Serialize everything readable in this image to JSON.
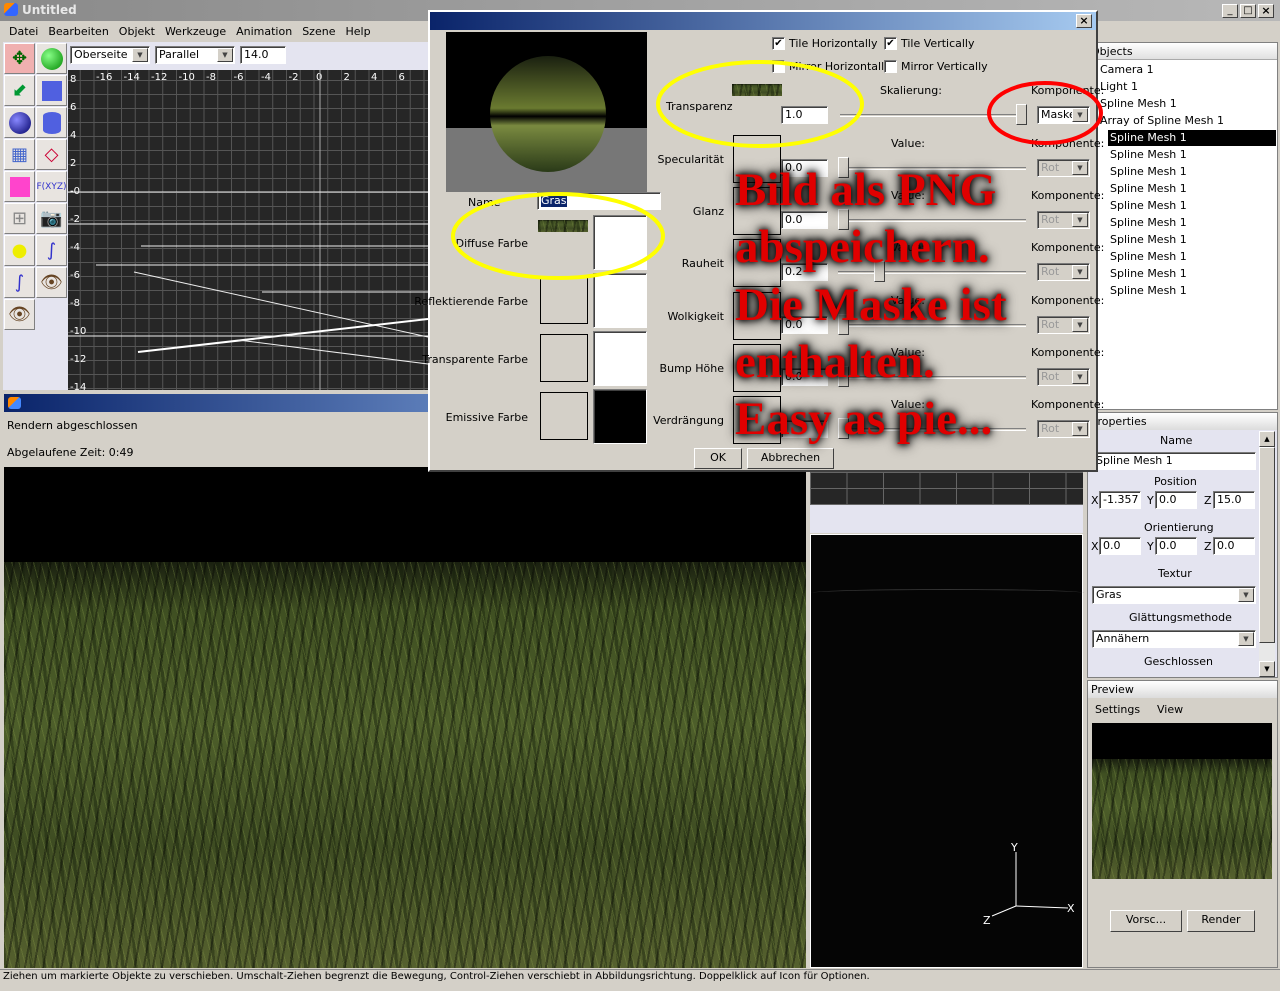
{
  "app": {
    "title": "Untitled",
    "window_controls": [
      "_",
      "□",
      "×"
    ]
  },
  "menu": [
    "Datei",
    "Bearbeiten",
    "Objekt",
    "Werkzeuge",
    "Animation",
    "Szene",
    "Help"
  ],
  "toolbar": {
    "view": "Oberseite",
    "projection": "Parallel",
    "scale": "14.0"
  },
  "tools": [
    "move-tool",
    "rotate-tool",
    "scale-tool",
    "cube",
    "sphere",
    "cylinder",
    "polygon-mesh",
    "polygon-shapes",
    "custom-object",
    "function-xyz",
    "csg-tree",
    "camera",
    "light",
    "spline-curve",
    "curve",
    "move-view",
    "rotate-view"
  ],
  "tool_text": {
    "fxyz": "F(XYZ)"
  },
  "viewport": {
    "x_ticks": [
      "-16",
      "-14",
      "-12",
      "-10",
      "-8",
      "-6",
      "-4",
      "-2",
      "0",
      "2",
      "4",
      "6"
    ],
    "y_ticks": [
      "8",
      "6",
      "4",
      "2",
      "-0",
      "-2",
      "-4",
      "-6",
      "-8",
      "-10",
      "-12",
      "-14"
    ]
  },
  "render_window": {
    "status": "Rendern abgeschlossen",
    "elapsed": "Abgelaufene Zeit: 0:49"
  },
  "objects": {
    "header": "Objects",
    "items": [
      "Camera 1",
      "Light 1",
      "Spline Mesh 1",
      "Array of Spline Mesh 1"
    ],
    "children": [
      "Spline Mesh 1",
      "Spline Mesh 1",
      "Spline Mesh 1",
      "Spline Mesh 1",
      "Spline Mesh 1",
      "Spline Mesh 1",
      "Spline Mesh 1",
      "Spline Mesh 1",
      "Spline Mesh 1",
      "Spline Mesh 1"
    ]
  },
  "properties": {
    "header": "Properties",
    "name_label": "Name",
    "name": "Spline Mesh 1",
    "position_label": "Position",
    "position": {
      "x": "-1.357",
      "y": "0.0",
      "z": "15.0"
    },
    "orientation_label": "Orientierung",
    "orientation": {
      "x": "0.0",
      "y": "0.0",
      "z": "0.0"
    },
    "axis": {
      "x": "X",
      "y": "Y",
      "z": "Z"
    },
    "texture_label": "Textur",
    "texture": "Gras",
    "smoothing_label": "Glättungsmethode",
    "smoothing": "Annähern",
    "closed_label": "Geschlossen"
  },
  "preview": {
    "header": "Preview",
    "menu": [
      "Settings",
      "View"
    ],
    "preview_button": "Vorsc...",
    "render_button": "Render"
  },
  "gizmo": {
    "x": "X",
    "y": "Y",
    "z": "Z"
  },
  "dialog": {
    "name_label": "Name",
    "name": "Gras",
    "colors": [
      {
        "label": "Diffuse Farbe",
        "color": "#ffffff",
        "textured": true
      },
      {
        "label": "Reflektierende Farbe",
        "color": "#ffffff"
      },
      {
        "label": "Transparente Farbe",
        "color": "#ffffff"
      },
      {
        "label": "Emissive Farbe",
        "color": "#000000"
      }
    ],
    "checkboxes": [
      {
        "label": "Tile Horizontally",
        "checked": true
      },
      {
        "label": "Tile Vertically",
        "checked": true
      },
      {
        "label": "Mirror Horizontally",
        "checked": false
      },
      {
        "label": "Mirror Vertically",
        "checked": false
      }
    ],
    "transparency": {
      "label": "Transparenz",
      "value": "1.0",
      "scale_label": "Skalierung:",
      "component_label": "Komponente:",
      "component": "Maske",
      "slider": 1.0
    },
    "value_label": "Value:",
    "component_label": "Komponente:",
    "rows": [
      {
        "label": "Specularität",
        "value": "0.0",
        "slider": 0.0,
        "component": "Rot"
      },
      {
        "label": "Glanz",
        "value": "0.0",
        "slider": 0.0,
        "component": "Rot"
      },
      {
        "label": "Rauheit",
        "value": "0.2",
        "slider": 0.2,
        "component": "Rot"
      },
      {
        "label": "Wolkigkeit",
        "value": "0.0",
        "slider": 0.0,
        "component": "Rot"
      },
      {
        "label": "Bump Höhe",
        "value": "0.0",
        "slider": 0.0,
        "component": "Rot"
      },
      {
        "label": "Verdrängung",
        "value": "",
        "slider": 0.0,
        "component": "Rot"
      }
    ],
    "ok": "OK",
    "cancel": "Abbrechen",
    "close": "×"
  },
  "annotation": {
    "lines": [
      "Bild als PNG",
      "abspeichern.",
      "Die Maske ist",
      "enthalten.",
      "Easy as pie..."
    ],
    "color": "#e00000"
  },
  "statusbar": "Ziehen um markierte Objekte zu verschieben. Umschalt-Ziehen begrenzt die Bewegung, Control-Ziehen verschiebt in Abbildungsrichtung. Doppelklick auf Icon für Optionen."
}
